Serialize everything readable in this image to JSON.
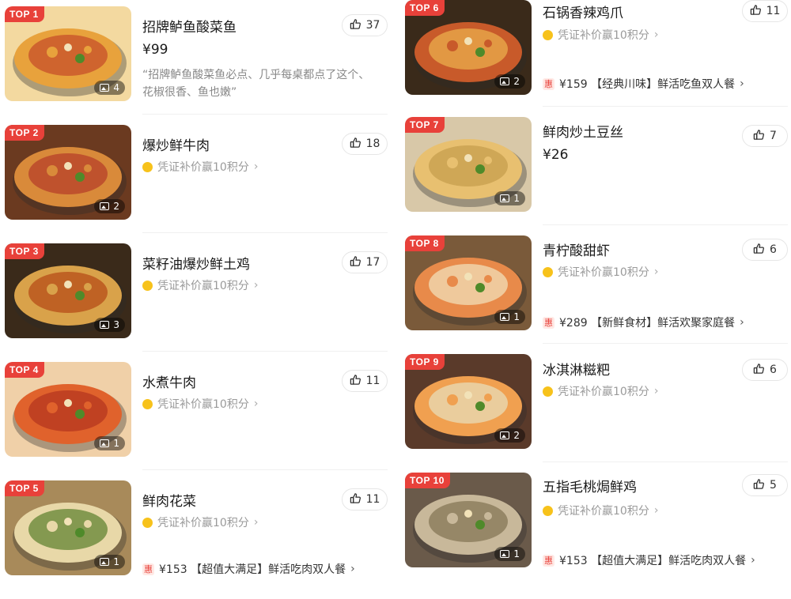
{
  "left": [
    {
      "rank": "TOP 1",
      "name": "招牌鲈鱼酸菜鱼",
      "price": "¥99",
      "quote": "“招牌鲈鱼酸菜鱼必点、几乎每桌都点了这个、花椒很香、鱼也嫩”",
      "likes": "37",
      "images": "4",
      "reward": "",
      "deal": ""
    },
    {
      "rank": "TOP 2",
      "name": "爆炒鲜牛肉",
      "price": "",
      "quote": "",
      "likes": "18",
      "images": "2",
      "reward": "凭证补价赢10积分",
      "deal": ""
    },
    {
      "rank": "TOP 3",
      "name": "菜籽油爆炒鲜土鸡",
      "price": "",
      "quote": "",
      "likes": "17",
      "images": "3",
      "reward": "凭证补价赢10积分",
      "deal": ""
    },
    {
      "rank": "TOP 4",
      "name": "水煮牛肉",
      "price": "",
      "quote": "",
      "likes": "11",
      "images": "1",
      "reward": "凭证补价赢10积分",
      "deal": ""
    },
    {
      "rank": "TOP 5",
      "name": "鲜肉花菜",
      "price": "",
      "quote": "",
      "likes": "11",
      "images": "1",
      "reward": "凭证补价赢10积分",
      "deal": "¥153 【超值大满足】鲜活吃肉双人餐"
    }
  ],
  "right": [
    {
      "rank": "TOP 6",
      "name": "石锅香辣鸡爪",
      "price": "",
      "quote": "",
      "likes": "11",
      "images": "2",
      "reward": "凭证补价赢10积分",
      "deal": "¥159 【经典川味】鲜活吃鱼双人餐"
    },
    {
      "rank": "TOP 7",
      "name": "鲜肉炒土豆丝",
      "price": "¥26",
      "quote": "",
      "likes": "7",
      "images": "1",
      "reward": "",
      "deal": ""
    },
    {
      "rank": "TOP 8",
      "name": "青柠酸甜虾",
      "price": "",
      "quote": "",
      "likes": "6",
      "images": "1",
      "reward": "凭证补价赢10积分",
      "deal": "¥289 【新鲜食材】鲜活欢聚家庭餐"
    },
    {
      "rank": "TOP 9",
      "name": "冰淇淋糍粑",
      "price": "",
      "quote": "",
      "likes": "6",
      "images": "2",
      "reward": "凭证补价赢10积分",
      "deal": ""
    },
    {
      "rank": "TOP 10",
      "name": "五指毛桃焗鲜鸡",
      "price": "",
      "quote": "",
      "likes": "5",
      "images": "1",
      "reward": "凭证补价赢10积分",
      "deal": "¥153 【超值大满足】鲜活吃肉双人餐"
    }
  ],
  "labels": {
    "deal_badge": "惠"
  },
  "colors": {
    "accent": "#e8413a",
    "coin": "#f7c21b"
  }
}
